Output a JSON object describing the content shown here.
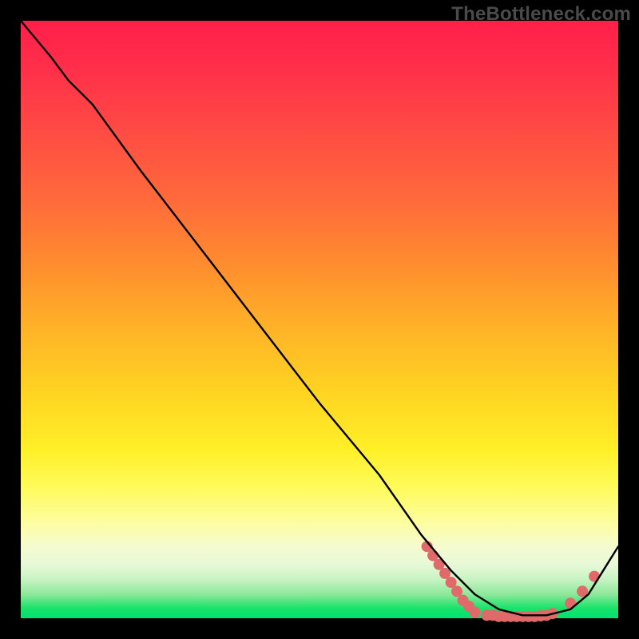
{
  "watermark": "TheBottleneck.com",
  "chart_data": {
    "type": "line",
    "title": "",
    "xlabel": "",
    "ylabel": "",
    "xlim": [
      0,
      100
    ],
    "ylim": [
      0,
      100
    ],
    "grid": false,
    "legend": false,
    "series": [
      {
        "name": "bottleneck-curve",
        "color": "#000000",
        "x": [
          0,
          5,
          8,
          12,
          20,
          30,
          40,
          50,
          60,
          67,
          72,
          76,
          80,
          84,
          88,
          92,
          95,
          100
        ],
        "y": [
          100,
          94,
          90,
          86,
          75,
          62,
          49,
          36,
          24,
          14,
          8,
          4,
          1.5,
          0.5,
          0.5,
          1.5,
          4,
          12
        ]
      }
    ],
    "markers": {
      "name": "bottleneck-markers",
      "color": "#e06a6a",
      "points": [
        {
          "x": 68,
          "y": 12
        },
        {
          "x": 69,
          "y": 10.5
        },
        {
          "x": 70,
          "y": 9
        },
        {
          "x": 71,
          "y": 7.5
        },
        {
          "x": 72,
          "y": 6
        },
        {
          "x": 73,
          "y": 4.5
        },
        {
          "x": 74,
          "y": 3
        },
        {
          "x": 75,
          "y": 2
        },
        {
          "x": 76,
          "y": 1
        },
        {
          "x": 78,
          "y": 0.5
        },
        {
          "x": 79,
          "y": 0.5
        },
        {
          "x": 80,
          "y": 0.3
        },
        {
          "x": 81,
          "y": 0.3
        },
        {
          "x": 82,
          "y": 0.3
        },
        {
          "x": 83,
          "y": 0.3
        },
        {
          "x": 84,
          "y": 0.3
        },
        {
          "x": 85,
          "y": 0.3
        },
        {
          "x": 86,
          "y": 0.3
        },
        {
          "x": 87,
          "y": 0.4
        },
        {
          "x": 88,
          "y": 0.5
        },
        {
          "x": 89,
          "y": 0.8
        },
        {
          "x": 92,
          "y": 2.5
        },
        {
          "x": 94,
          "y": 4.5
        },
        {
          "x": 96,
          "y": 7
        }
      ]
    }
  }
}
